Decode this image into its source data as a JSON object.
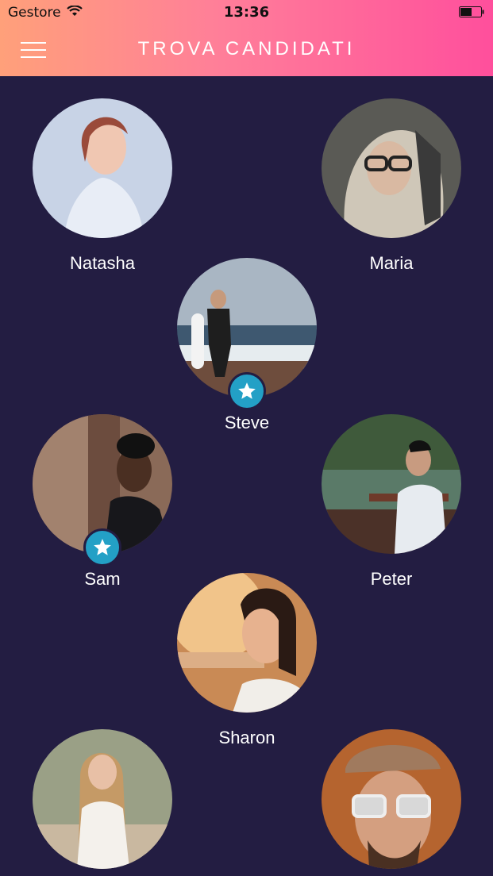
{
  "status": {
    "carrier": "Gestore",
    "time": "13:36"
  },
  "header": {
    "title": "TROVA CANDIDATI"
  },
  "candidates": [
    {
      "name": "Natasha",
      "starred": false
    },
    {
      "name": "Maria",
      "starred": false
    },
    {
      "name": "Steve",
      "starred": true
    },
    {
      "name": "Sam",
      "starred": true
    },
    {
      "name": "Peter",
      "starred": false
    },
    {
      "name": "Sharon",
      "starred": false
    },
    {
      "name": "",
      "starred": false
    },
    {
      "name": "",
      "starred": false
    }
  ],
  "colors": {
    "background": "#231d42",
    "header_start": "#ffa07a",
    "header_end": "#ff4f9c",
    "badge": "#23a0c6"
  }
}
